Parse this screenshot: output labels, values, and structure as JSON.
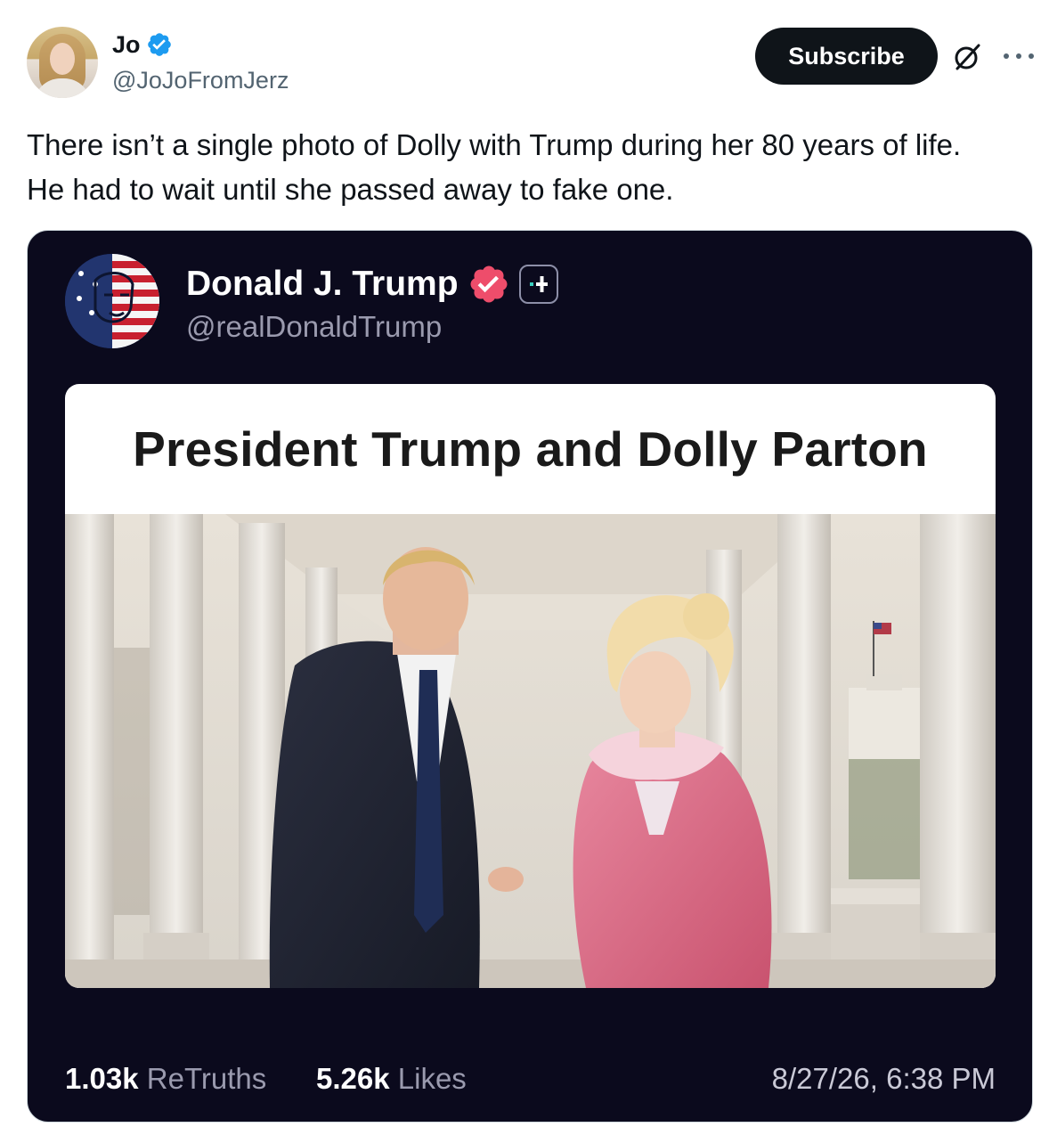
{
  "author": {
    "display_name": "Jo",
    "handle": "@JoJoFromJerz",
    "verified": true
  },
  "actions": {
    "subscribe_label": "Subscribe",
    "grok_icon": "grok-icon",
    "more_icon": "more-icon"
  },
  "post": {
    "text_line1": "There isn’t a single photo of Dolly with Trump during her 80 years of life.",
    "text_line2": "He had to wait until she passed away to fake one."
  },
  "embed": {
    "author": {
      "display_name": "Donald J. Trump",
      "handle": "@realDonaldTrump",
      "verified_color": "#ee4d6b"
    },
    "card_title": "President Trump and Dolly Parton",
    "retruths_count": "1.03k",
    "retruths_label": "ReTruths",
    "likes_count": "5.26k",
    "likes_label": "Likes",
    "timestamp": "8/27/26, 6:38 PM"
  },
  "colors": {
    "accent_blue": "#1d9bf0",
    "embed_background": "#0b0a1d",
    "subscribe_background": "#0f1419"
  }
}
